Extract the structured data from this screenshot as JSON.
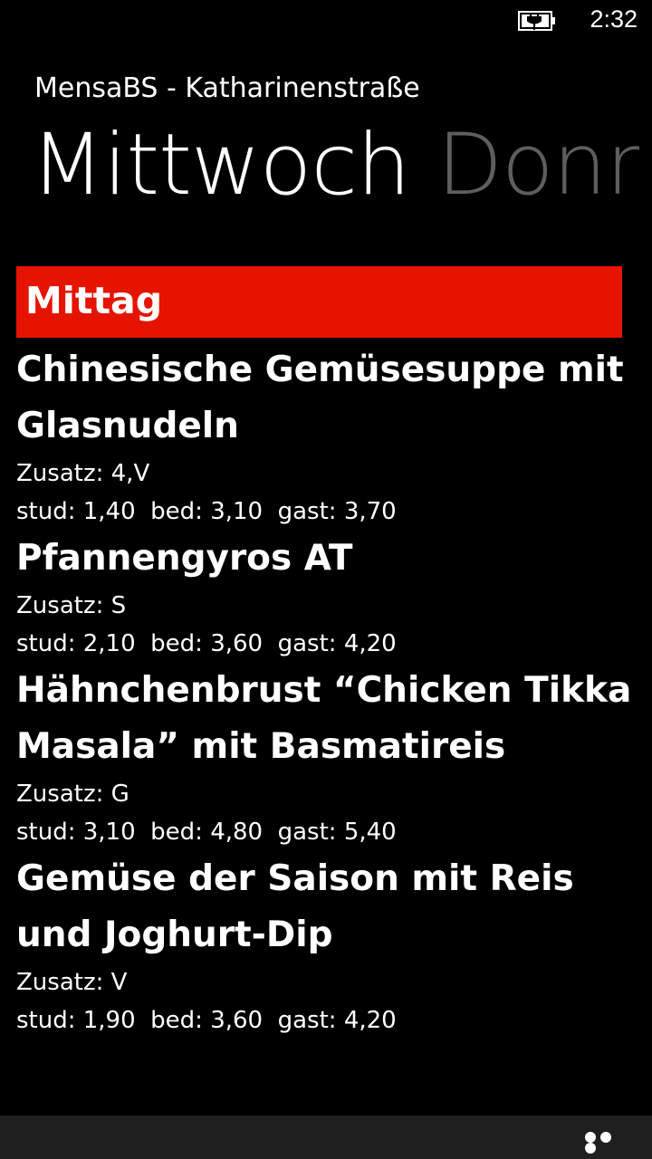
{
  "status_bar": {
    "time": "2:32",
    "battery_icon": "battery-charging-icon"
  },
  "header": {
    "app_title": "MensaBS - Katharinenstraße",
    "pivot_tabs": [
      {
        "label": "Mittwoch",
        "active": true
      },
      {
        "label": "Donnerstag",
        "active": false
      }
    ]
  },
  "section": {
    "title": "Mittag",
    "accent_color": "#e51400"
  },
  "dishes": [
    {
      "name": "Chinesische Gemüsesuppe mit Glasnudeln",
      "zusatz": "Zusatz: 4,V",
      "prices": "stud: 1,40  bed: 3,10  gast: 3,70"
    },
    {
      "name": "Pfannengyros AT",
      "zusatz": "Zusatz: S",
      "prices": "stud: 2,10  bed: 3,60  gast: 4,20"
    },
    {
      "name": "Hähnchenbrust “Chicken Tikka Masala” mit Basmatireis",
      "zusatz": "Zusatz: G",
      "prices": "stud: 3,10  bed: 4,80  gast: 5,40"
    },
    {
      "name": "Gemüse der Saison mit Reis und Joghurt-Dip",
      "zusatz": "Zusatz: V",
      "prices": "stud: 1,90  bed: 3,60  gast: 4,20"
    }
  ],
  "app_bar": {
    "more_icon": "ellipsis-icon"
  }
}
